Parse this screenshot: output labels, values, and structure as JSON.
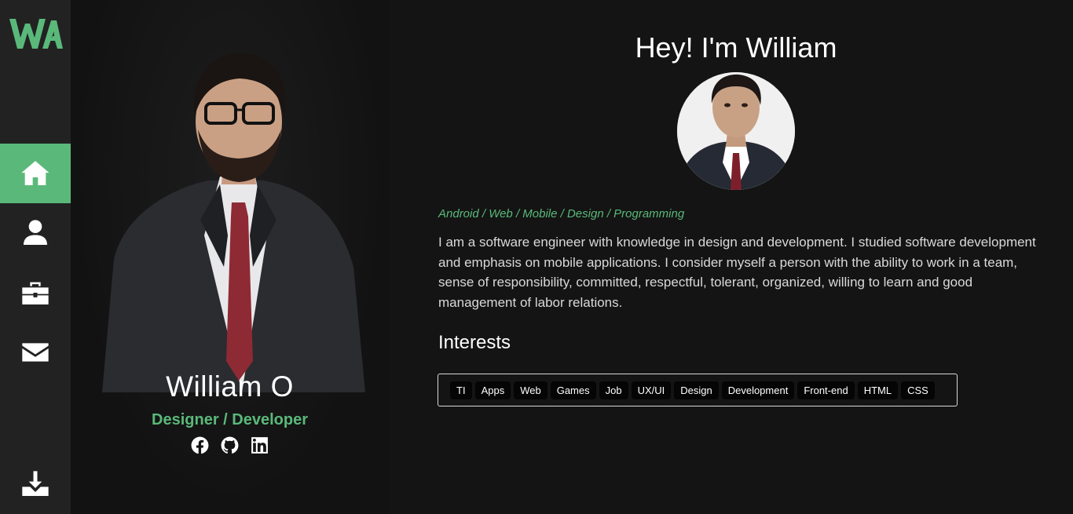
{
  "sidebar": {
    "logo_text": "WA",
    "nav": [
      {
        "name": "home",
        "icon": "home-icon",
        "active": true
      },
      {
        "name": "about",
        "icon": "user-icon",
        "active": false
      },
      {
        "name": "work",
        "icon": "briefcase-icon",
        "active": false
      },
      {
        "name": "contact",
        "icon": "envelope-icon",
        "active": false
      }
    ],
    "download_icon": "download-icon"
  },
  "hero": {
    "name": "William O",
    "role": "Designer / Developer",
    "socials": [
      "facebook-icon",
      "github-icon",
      "linkedin-icon"
    ]
  },
  "main": {
    "greeting": "Hey! I'm William",
    "tagline": "Android / Web / Mobile / Design / Programming",
    "bio": "I am a software engineer with knowledge in design and development. I studied software development and emphasis on mobile applications. I consider myself a person with the ability to work in a team, sense of responsibility, committed, respectful, tolerant, organized, willing to learn and good management of labor relations.",
    "interests_title": "Interests",
    "interests": [
      "TI",
      "Apps",
      "Web",
      "Games",
      "Job",
      "UX/UI",
      "Design",
      "Development",
      "Front-end",
      "HTML",
      "CSS"
    ]
  },
  "colors": {
    "accent": "#5ab97a",
    "sidebar_bg": "#222222",
    "page_bg": "#141414"
  }
}
